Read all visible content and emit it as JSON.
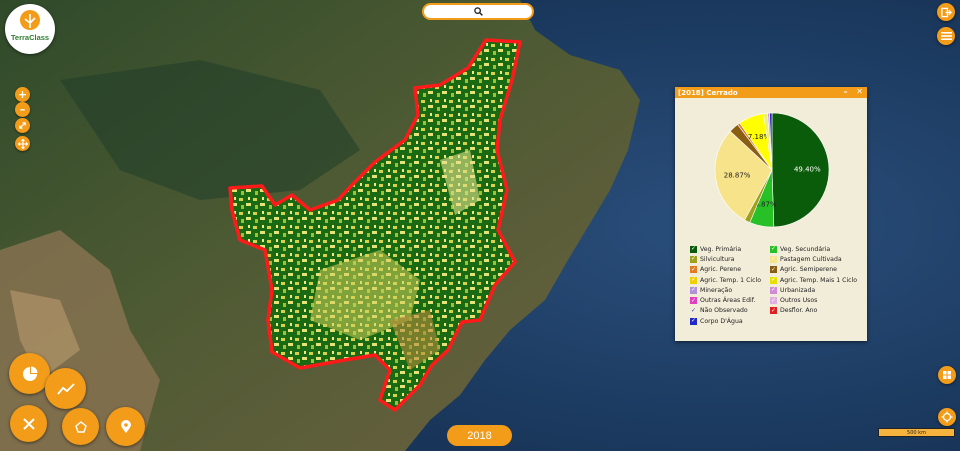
{
  "app": {
    "logo_text": "TerraClass"
  },
  "year": "2018",
  "scale_label": "500 km",
  "panel": {
    "title": "[2018] Cerrado",
    "minimize": "–",
    "close": "✕"
  },
  "colors": {
    "accent": "#f39c1a",
    "boundary": "#ff1a1a"
  },
  "chart_data": {
    "type": "pie",
    "slices": [
      {
        "label": "Veg. Primária",
        "value": 49.4,
        "color": "#0a5c0a",
        "data_label": "49.40%"
      },
      {
        "label": "Veg. Secundária",
        "value": 6.87,
        "color": "#27c027",
        "data_label": "6.87%"
      },
      {
        "label": "Silvicultura",
        "value": 1.6,
        "color": "#a0a020",
        "data_label": ""
      },
      {
        "label": "Pastagem Cultivada",
        "value": 28.87,
        "color": "#f7e38a",
        "data_label": "28.87%"
      },
      {
        "label": "Agric. Semiperene",
        "value": 2.8,
        "color": "#8a5e12",
        "data_label": ""
      },
      {
        "label": "Agric. Perene",
        "value": 0.7,
        "color": "#e07b22",
        "data_label": ""
      },
      {
        "label": "Agric. Temp. Mais 1 Ciclo",
        "value": 7.18,
        "color": "#ffff00",
        "data_label": "7.18%"
      },
      {
        "label": "Agric. Temp. 1 Ciclo",
        "value": 1.2,
        "color": "#f0f070",
        "data_label": ""
      },
      {
        "label": "Urbanizada",
        "value": 0.5,
        "color": "#d08ad8",
        "data_label": ""
      },
      {
        "label": "Corpo D'Água",
        "value": 0.7,
        "color": "#2028c8",
        "data_label": ""
      }
    ]
  },
  "legend": [
    {
      "label": "Veg. Primária",
      "color": "#0a5c0a",
      "checked": true
    },
    {
      "label": "Veg. Secundária",
      "color": "#27c027",
      "checked": true
    },
    {
      "label": "Silvicultura",
      "color": "#a0a020",
      "checked": true
    },
    {
      "label": "Pastagem Cultivada",
      "color": "#f7e38a",
      "checked": true
    },
    {
      "label": "Agric. Perene",
      "color": "#e07b22",
      "checked": true
    },
    {
      "label": "Agric. Semiperene",
      "color": "#8a5e12",
      "checked": true
    },
    {
      "label": "Agric. Temp. 1 Ciclo",
      "color": "#f0d000",
      "checked": true
    },
    {
      "label": "Agric. Temp. Mais 1 Ciclo",
      "color": "#e8e000",
      "checked": true
    },
    {
      "label": "Mineração",
      "color": "#b090d8",
      "checked": true
    },
    {
      "label": "Urbanizada",
      "color": "#d08ad8",
      "checked": true
    },
    {
      "label": "Outras Áreas Edif.",
      "color": "#e040c0",
      "checked": true
    },
    {
      "label": "Outros Usos",
      "color": "#e0b0e0",
      "checked": true
    },
    {
      "label": "Não Observado",
      "color": "#ffffff",
      "checked": false
    },
    {
      "label": "Desflor. Ano",
      "color": "#e02020",
      "checked": true
    },
    {
      "label": "Corpo D'Água",
      "color": "#2028c8",
      "checked": true
    }
  ],
  "icons": {
    "search": "search-icon",
    "logout": "logout-icon",
    "menu": "menu-icon",
    "zoom_in": "plus-icon",
    "zoom_out": "minus-icon",
    "fullscreen": "expand-icon",
    "pan": "move-icon",
    "layers": "layers-icon",
    "locate": "locate-icon",
    "pie_tool": "pie-chart-icon",
    "chart_tool": "line-chart-icon",
    "tools": "tools-icon",
    "polygon_tool": "polygon-icon",
    "marker_tool": "marker-icon"
  }
}
